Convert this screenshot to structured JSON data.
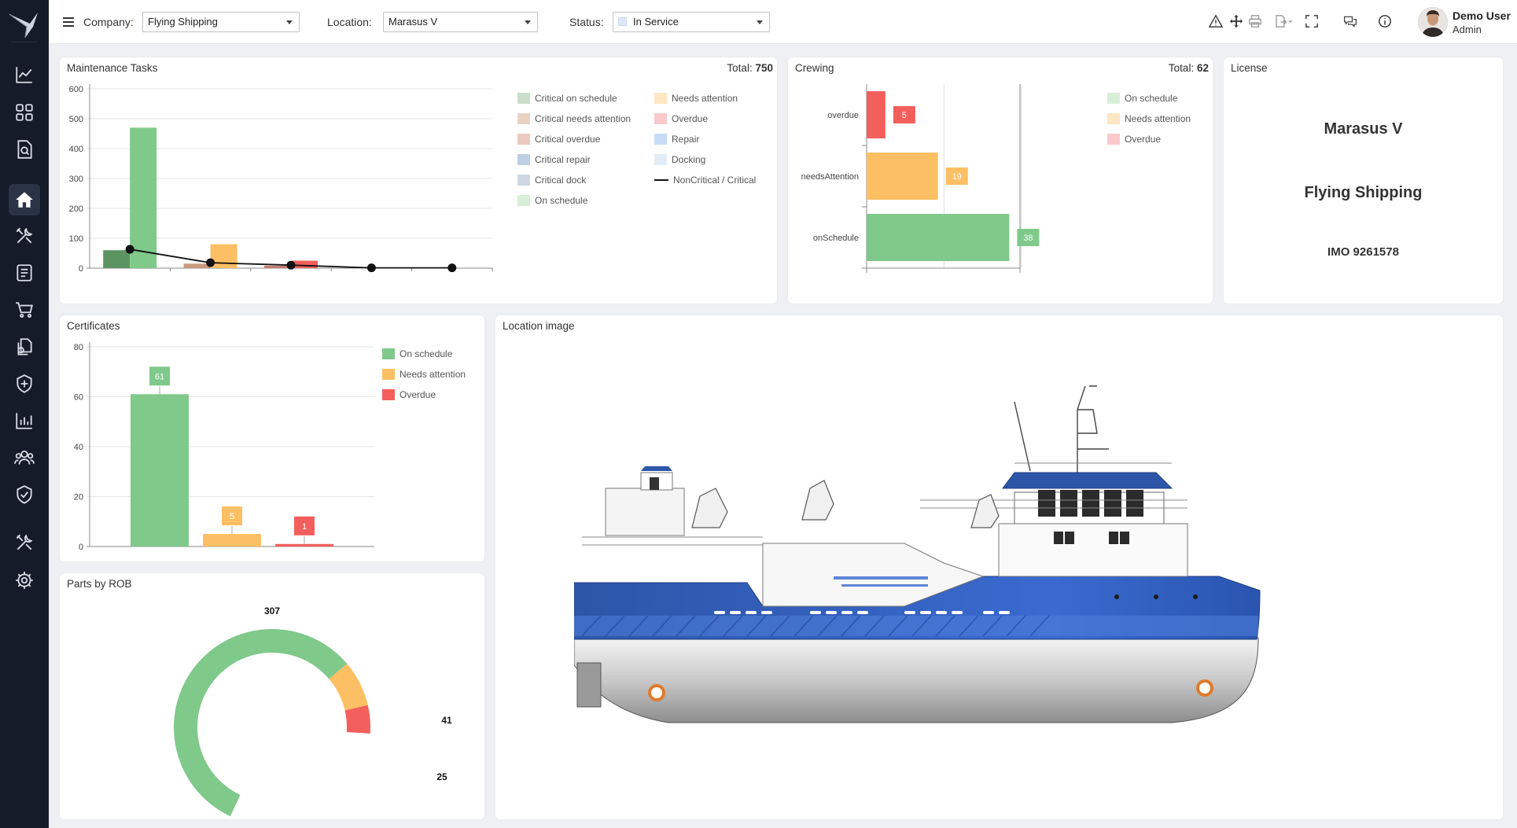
{
  "topbar": {
    "company_label": "Company:",
    "company_value": "Flying Shipping",
    "location_label": "Location:",
    "location_value": "Marasus V",
    "status_label": "Status:",
    "status_value": "In Service",
    "status_color": "#dbe9f7",
    "icons": [
      "alert-icon",
      "move-icon",
      "print-icon",
      "export-icon",
      "fullscreen-icon",
      "chat-icon",
      "info-icon"
    ],
    "user_name": "Demo User",
    "user_role": "Admin"
  },
  "sidebar": {
    "items": [
      "analytics-icon",
      "grid-icon",
      "document-search-icon",
      "home-icon",
      "tools-icon",
      "checklist-icon",
      "cart-icon",
      "documents-icon",
      "shield-plus-icon",
      "bar-chart-icon",
      "users-icon",
      "shield-check-icon",
      "wrench-cross-icon",
      "gear-icon"
    ],
    "active": "home-icon"
  },
  "maintenance": {
    "title": "Maintenance Tasks",
    "total_label": "Total:",
    "total_value": "750",
    "legend": [
      {
        "label": "Critical on schedule",
        "color": "#c9dfc9"
      },
      {
        "label": "Critical needs attention",
        "color": "#e9d2c3"
      },
      {
        "label": "Critical overdue",
        "color": "#ebc9bf"
      },
      {
        "label": "Critical repair",
        "color": "#bcd0e2"
      },
      {
        "label": "Critical dock",
        "color": "#cfd8e2"
      },
      {
        "label": "On schedule",
        "color": "#d8eed8"
      },
      {
        "label": "Needs attention",
        "color": "#fde6c2"
      },
      {
        "label": "Overdue",
        "color": "#f9c9cc"
      },
      {
        "label": "Repair",
        "color": "#c6ddf4"
      },
      {
        "label": "Docking",
        "color": "#e2ecf6"
      },
      {
        "label": "NonCritical / Critical",
        "color": "#111111"
      }
    ]
  },
  "crewing": {
    "title": "Crewing",
    "total_label": "Total:",
    "total_value": "62",
    "legend": [
      {
        "label": "On schedule",
        "color": "#d8eed8"
      },
      {
        "label": "Needs attention",
        "color": "#fde6c2"
      },
      {
        "label": "Overdue",
        "color": "#f9c9cc"
      }
    ]
  },
  "license": {
    "title": "License",
    "vessel": "Marasus V",
    "company": "Flying Shipping",
    "imo": "IMO 9261578"
  },
  "certificates": {
    "title": "Certificates",
    "legend": [
      {
        "label": "On schedule",
        "color": "#7fc98a"
      },
      {
        "label": "Needs attention",
        "color": "#fdbf63"
      },
      {
        "label": "Overdue",
        "color": "#f25f5c"
      }
    ]
  },
  "parts": {
    "title": "Parts by ROB"
  },
  "location_image": {
    "title": "Location image"
  },
  "chart_data": [
    {
      "type": "bar",
      "name": "maintenance",
      "ylim": [
        0,
        600
      ],
      "yticks": [
        0,
        100,
        200,
        300,
        400,
        500,
        600
      ],
      "categories": [
        "On schedule",
        "Needs attention",
        "Overdue",
        "Repair",
        "Docking"
      ],
      "series": [
        {
          "name": "Critical",
          "values": [
            60,
            15,
            8,
            0,
            0
          ],
          "colors": [
            "#5c9461",
            "#c99b7f",
            "#c67b70",
            "#8da6bf",
            "#a4b2c2"
          ]
        },
        {
          "name": "NonCritical",
          "values": [
            470,
            80,
            25,
            0,
            0
          ],
          "colors": [
            "#7fc98a",
            "#fdbf63",
            "#f25f5c",
            "#8bb9e6",
            "#c9dbee"
          ]
        }
      ],
      "line": {
        "name": "NonCritical / Critical",
        "values": [
          63,
          18,
          10,
          1,
          1
        ]
      }
    },
    {
      "type": "bar",
      "name": "crewing",
      "orientation": "horizontal",
      "categories": [
        "overdue",
        "needsAttention",
        "onSchedule"
      ],
      "values": [
        5,
        19,
        38
      ],
      "colors": [
        "#f25f5c",
        "#fdbf63",
        "#7fc98a"
      ],
      "xlim": [
        0,
        60
      ]
    },
    {
      "type": "bar",
      "name": "certificates",
      "categories": [
        "On schedule",
        "Needs attention",
        "Overdue"
      ],
      "values": [
        61,
        5,
        1
      ],
      "colors": [
        "#7fc98a",
        "#fdbf63",
        "#f25f5c"
      ],
      "ylim": [
        0,
        80
      ],
      "yticks": [
        0,
        20,
        40,
        60,
        80
      ]
    },
    {
      "type": "pie",
      "name": "parts",
      "categories": [
        "On schedule",
        "Needs attention",
        "Overdue"
      ],
      "values": [
        307,
        41,
        25
      ],
      "colors": [
        "#7fc98a",
        "#fdbf63",
        "#f25f5c"
      ]
    }
  ]
}
